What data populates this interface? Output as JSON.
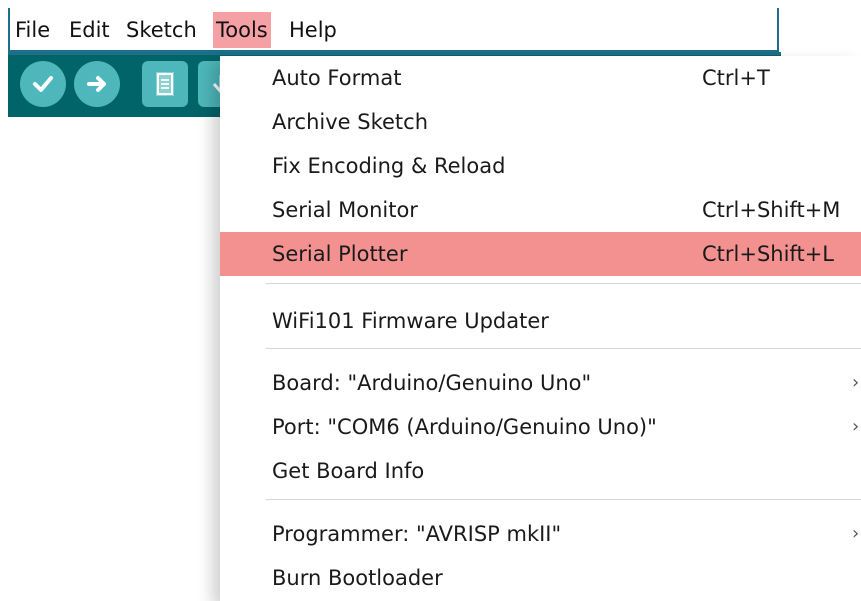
{
  "menubar": {
    "items": [
      {
        "label": "File",
        "active": false
      },
      {
        "label": "Edit",
        "active": false
      },
      {
        "label": "Sketch",
        "active": false
      },
      {
        "label": "Tools",
        "active": true
      },
      {
        "label": "Help",
        "active": false
      }
    ]
  },
  "toolbar": {
    "buttons": [
      {
        "icon": "verify-check-icon"
      },
      {
        "icon": "upload-arrow-icon"
      },
      {
        "icon": "new-file-icon"
      },
      {
        "icon": "open-icon"
      }
    ],
    "color": "#006468",
    "button_color": "#4db7bb"
  },
  "tools_menu": {
    "items": [
      {
        "label": "Auto Format",
        "shortcut": "Ctrl+T"
      },
      {
        "label": "Archive Sketch",
        "shortcut": ""
      },
      {
        "label": "Fix Encoding & Reload",
        "shortcut": ""
      },
      {
        "label": "Serial Monitor",
        "shortcut": "Ctrl+Shift+M"
      },
      {
        "label": "Serial Plotter",
        "shortcut": "Ctrl+Shift+L",
        "highlighted": true
      },
      {
        "label": "WiFi101 Firmware Updater",
        "shortcut": ""
      },
      {
        "label": "Board: \"Arduino/Genuino Uno\"",
        "submenu": true
      },
      {
        "label": "Port: \"COM6 (Arduino/Genuino Uno)\"",
        "submenu": true
      },
      {
        "label": "Get Board Info",
        "shortcut": ""
      },
      {
        "label": "Programmer: \"AVRISP mkII\"",
        "submenu": true
      },
      {
        "label": "Burn Bootloader",
        "shortcut": ""
      }
    ],
    "highlight_color": "#f39191",
    "submenu_arrow": "›"
  }
}
